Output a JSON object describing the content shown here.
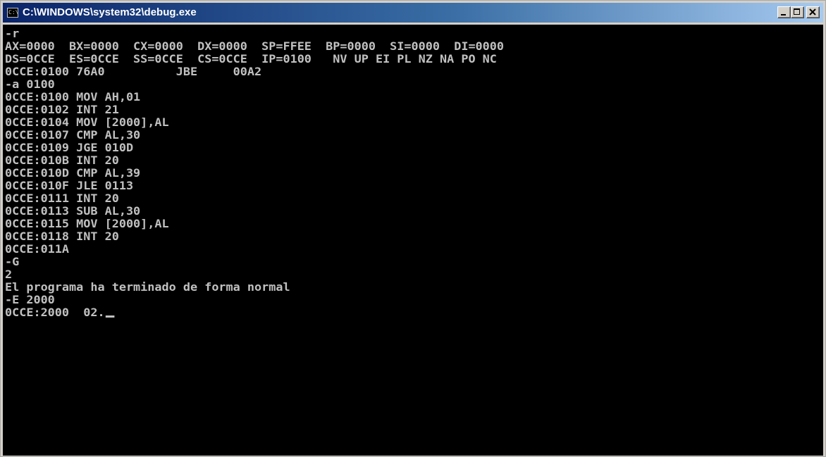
{
  "window": {
    "title": "C:\\WINDOWS\\system32\\debug.exe",
    "icon_label": "C:\\"
  },
  "console": {
    "lines": [
      "-r",
      "AX=0000  BX=0000  CX=0000  DX=0000  SP=FFEE  BP=0000  SI=0000  DI=0000",
      "DS=0CCE  ES=0CCE  SS=0CCE  CS=0CCE  IP=0100   NV UP EI PL NZ NA PO NC",
      "0CCE:0100 76A0          JBE     00A2",
      "-a 0100",
      "0CCE:0100 MOV AH,01",
      "0CCE:0102 INT 21",
      "0CCE:0104 MOV [2000],AL",
      "0CCE:0107 CMP AL,30",
      "0CCE:0109 JGE 010D",
      "0CCE:010B INT 20",
      "0CCE:010D CMP AL,39",
      "0CCE:010F JLE 0113",
      "0CCE:0111 INT 20",
      "0CCE:0113 SUB AL,30",
      "0CCE:0115 MOV [2000],AL",
      "0CCE:0118 INT 20",
      "0CCE:011A",
      "-G",
      "2",
      "El programa ha terminado de forma normal",
      "-E 2000",
      "0CCE:2000  02."
    ]
  },
  "colors": {
    "console_bg": "#000000",
    "console_fg": "#c0c0c0",
    "titlebar_start": "#0a246a",
    "titlebar_end": "#a6caf0"
  }
}
